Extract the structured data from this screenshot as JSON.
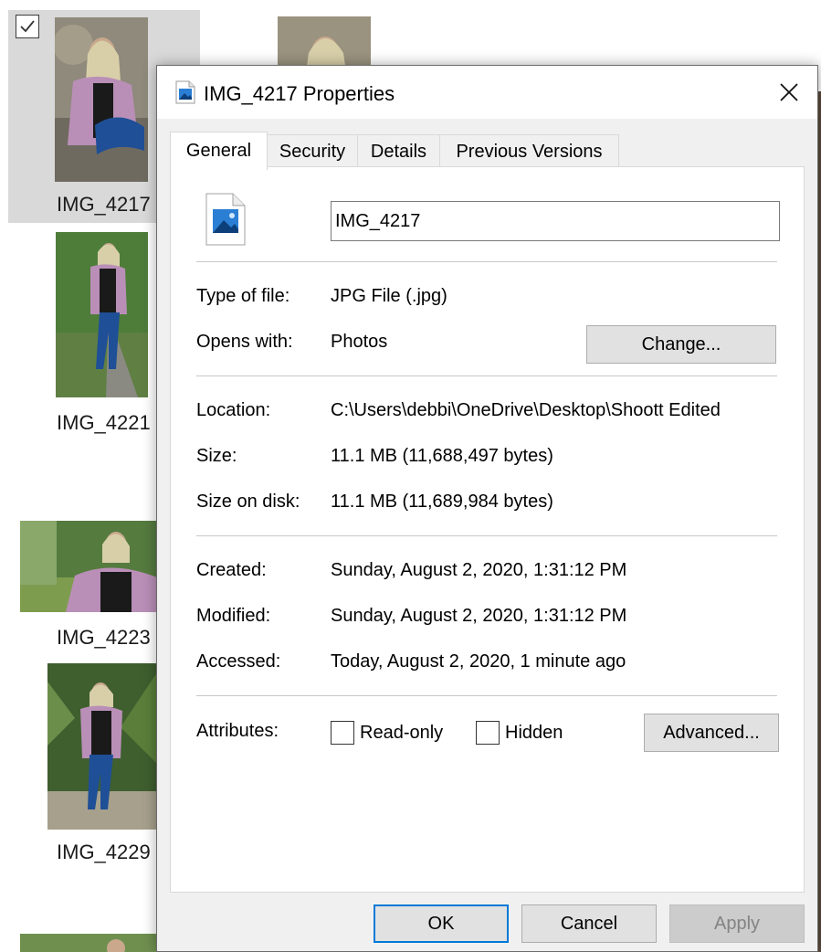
{
  "explorer": {
    "tiles": [
      {
        "label": "IMG_4217",
        "selected": true
      },
      {
        "label": "IMG_4221"
      },
      {
        "label": "IMG_4223"
      },
      {
        "label": "IMG_4229"
      }
    ]
  },
  "dialog": {
    "title": "IMG_4217 Properties",
    "tabs": [
      "General",
      "Security",
      "Details",
      "Previous Versions"
    ],
    "active_tab": "General",
    "file_name": "IMG_4217",
    "type_label": "Type of file:",
    "type_value": "JPG File (.jpg)",
    "opens_label": "Opens with:",
    "opens_value": "Photos",
    "change_button": "Change...",
    "location_label": "Location:",
    "location_value": "C:\\Users\\debbi\\OneDrive\\Desktop\\Shoott Edited",
    "size_label": "Size:",
    "size_value": "11.1 MB (11,688,497 bytes)",
    "size_disk_label": "Size on disk:",
    "size_disk_value": "11.1 MB (11,689,984 bytes)",
    "created_label": "Created:",
    "created_value": "Sunday, August 2, 2020, 1:31:12 PM",
    "modified_label": "Modified:",
    "modified_value": "Sunday, August 2, 2020, 1:31:12 PM",
    "accessed_label": "Accessed:",
    "accessed_value": "Today, August 2, 2020, 1 minute ago",
    "attributes_label": "Attributes:",
    "readonly_label": "Read-only",
    "hidden_label": "Hidden",
    "advanced_button": "Advanced...",
    "ok_button": "OK",
    "cancel_button": "Cancel",
    "apply_button": "Apply"
  },
  "colors": {
    "accent": "#0078d7",
    "selection": "#d9d9d9",
    "dialog_bg": "#f0f0f0"
  }
}
